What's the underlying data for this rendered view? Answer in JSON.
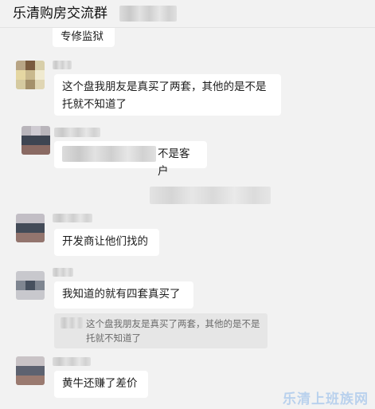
{
  "header": {
    "title": "乐清购房交流群"
  },
  "messages": [
    {
      "text": "专修监狱"
    },
    {
      "text": "这个盘我朋友是真买了两套，其他的是不是托就不知道了"
    },
    {
      "text": "不是客户"
    },
    {
      "text": "开发商让他们找的"
    },
    {
      "text": "我知道的就有四套真买了"
    },
    {
      "quote": "这个盘我朋友是真买了两套，其他的是不是托就不知道了"
    },
    {
      "text": "黄牛还赚了差价"
    }
  ],
  "watermark": "乐清上班族网"
}
